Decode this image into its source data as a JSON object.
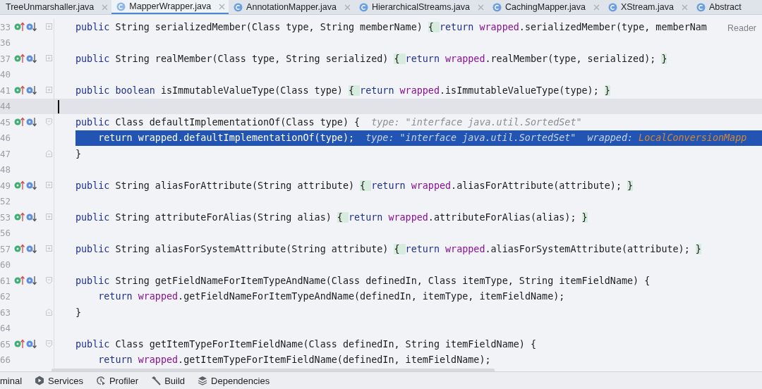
{
  "tabs": [
    {
      "label": "TreeUnmarshaller.java",
      "selected": false
    },
    {
      "label": "MapperWrapper.java",
      "selected": true
    },
    {
      "label": "AnnotationMapper.java",
      "selected": false
    },
    {
      "label": "HierarchicalStreams.java",
      "selected": false
    },
    {
      "label": "CachingMapper.java",
      "selected": false
    },
    {
      "label": "XStream.java",
      "selected": false
    },
    {
      "label": "Abstract",
      "selected": false
    }
  ],
  "reader_mode": "Reader",
  "lines": [
    {
      "number": "33",
      "kind": "folded",
      "markers": true,
      "selected": false,
      "current": false,
      "segments": [
        {
          "kind": "kw",
          "text": "public "
        },
        {
          "kind": "text",
          "text": "String serializedMember(Class type, String memberName) "
        },
        {
          "kind": "brace",
          "text": "{ "
        },
        {
          "kind": "kw",
          "text": "return "
        },
        {
          "kind": "field",
          "text": "wrapped"
        },
        {
          "kind": "text",
          "text": ".serializedMember(type, memberNam"
        }
      ]
    },
    {
      "number": "36",
      "kind": "blank",
      "markers": false,
      "selected": false,
      "current": false
    },
    {
      "number": "37",
      "kind": "folded",
      "markers": true,
      "selected": false,
      "current": false,
      "segments": [
        {
          "kind": "kw",
          "text": "public "
        },
        {
          "kind": "text",
          "text": "String realMember(Class type, String serialized) "
        },
        {
          "kind": "brace",
          "text": "{ "
        },
        {
          "kind": "kw",
          "text": "return "
        },
        {
          "kind": "field",
          "text": "wrapped"
        },
        {
          "kind": "text",
          "text": ".realMember(type, serialized); "
        },
        {
          "kind": "brace",
          "text": "}"
        }
      ]
    },
    {
      "number": "40",
      "kind": "blank",
      "markers": false,
      "selected": false,
      "current": false
    },
    {
      "number": "41",
      "kind": "folded",
      "markers": true,
      "selected": false,
      "current": false,
      "segments": [
        {
          "kind": "kw",
          "text": "public boolean "
        },
        {
          "kind": "text",
          "text": "isImmutableValueType(Class type) "
        },
        {
          "kind": "brace",
          "text": "{ "
        },
        {
          "kind": "kw",
          "text": "return "
        },
        {
          "kind": "field",
          "text": "wrapped"
        },
        {
          "kind": "text",
          "text": ".isImmutableValueType(type); "
        },
        {
          "kind": "brace",
          "text": "}"
        }
      ]
    },
    {
      "number": "44",
      "kind": "blank",
      "markers": false,
      "selected": false,
      "current": true
    },
    {
      "number": "45",
      "kind": "open",
      "markers": true,
      "selected": false,
      "current": false,
      "segments": [
        {
          "kind": "kw",
          "text": "public "
        },
        {
          "kind": "text",
          "text": "Class defaultImplementationOf(Class type) {"
        },
        {
          "kind": "hint",
          "text": "type: \"interface java.util.SortedSet\""
        }
      ]
    },
    {
      "number": "46",
      "kind": "body",
      "markers": false,
      "selected": true,
      "current": false,
      "segments": [
        {
          "kind": "kw",
          "text": "return "
        },
        {
          "kind": "field",
          "text": "wrapped"
        },
        {
          "kind": "text",
          "text": ".defaultImplementationOf(type);"
        },
        {
          "kind": "hint",
          "text": "type: \"interface java.util.SortedSet\""
        },
        {
          "kind": "hint",
          "text": "wrapped:"
        },
        {
          "kind": "hint-value",
          "text": "LocalConversionMapp"
        }
      ]
    },
    {
      "number": "47",
      "kind": "close",
      "markers": false,
      "selected": false,
      "current": false,
      "segments": [
        {
          "kind": "text",
          "text": "}"
        }
      ]
    },
    {
      "number": "48",
      "kind": "blank",
      "markers": false,
      "selected": false,
      "current": false
    },
    {
      "number": "49",
      "kind": "folded",
      "markers": true,
      "selected": false,
      "current": false,
      "segments": [
        {
          "kind": "kw",
          "text": "public "
        },
        {
          "kind": "text",
          "text": "String aliasForAttribute(String attribute) "
        },
        {
          "kind": "brace",
          "text": "{ "
        },
        {
          "kind": "kw",
          "text": "return "
        },
        {
          "kind": "field",
          "text": "wrapped"
        },
        {
          "kind": "text",
          "text": ".aliasForAttribute(attribute); "
        },
        {
          "kind": "brace",
          "text": "}"
        }
      ]
    },
    {
      "number": "52",
      "kind": "blank",
      "markers": false,
      "selected": false,
      "current": false
    },
    {
      "number": "53",
      "kind": "folded",
      "markers": true,
      "selected": false,
      "current": false,
      "segments": [
        {
          "kind": "kw",
          "text": "public "
        },
        {
          "kind": "text",
          "text": "String attributeForAlias(String alias) "
        },
        {
          "kind": "brace",
          "text": "{ "
        },
        {
          "kind": "kw",
          "text": "return "
        },
        {
          "kind": "field",
          "text": "wrapped"
        },
        {
          "kind": "text",
          "text": ".attributeForAlias(alias); "
        },
        {
          "kind": "brace",
          "text": "}"
        }
      ]
    },
    {
      "number": "56",
      "kind": "blank",
      "markers": false,
      "selected": false,
      "current": false
    },
    {
      "number": "57",
      "kind": "folded",
      "markers": true,
      "selected": false,
      "current": false,
      "segments": [
        {
          "kind": "kw",
          "text": "public "
        },
        {
          "kind": "text",
          "text": "String aliasForSystemAttribute(String attribute) "
        },
        {
          "kind": "brace",
          "text": "{ "
        },
        {
          "kind": "kw",
          "text": "return "
        },
        {
          "kind": "field",
          "text": "wrapped"
        },
        {
          "kind": "text",
          "text": ".aliasForSystemAttribute(attribute); "
        },
        {
          "kind": "brace",
          "text": "}"
        }
      ]
    },
    {
      "number": "60",
      "kind": "blank",
      "markers": false,
      "selected": false,
      "current": false
    },
    {
      "number": "61",
      "kind": "open",
      "markers": true,
      "selected": false,
      "current": false,
      "segments": [
        {
          "kind": "kw",
          "text": "public "
        },
        {
          "kind": "text",
          "text": "String getFieldNameForItemTypeAndName(Class definedIn, Class itemType, String itemFieldName) {"
        }
      ]
    },
    {
      "number": "62",
      "kind": "body",
      "markers": false,
      "selected": false,
      "current": false,
      "segments": [
        {
          "kind": "kw",
          "text": "return "
        },
        {
          "kind": "field",
          "text": "wrapped"
        },
        {
          "kind": "text",
          "text": ".getFieldNameForItemTypeAndName(definedIn, itemType, itemFieldName);"
        }
      ]
    },
    {
      "number": "63",
      "kind": "close",
      "markers": false,
      "selected": false,
      "current": false,
      "segments": [
        {
          "kind": "text",
          "text": "}"
        }
      ]
    },
    {
      "number": "64",
      "kind": "blank",
      "markers": false,
      "selected": false,
      "current": false
    },
    {
      "number": "65",
      "kind": "open",
      "markers": true,
      "selected": false,
      "current": false,
      "segments": [
        {
          "kind": "kw",
          "text": "public "
        },
        {
          "kind": "text",
          "text": "Class getItemTypeForItemFieldName(Class definedIn, String itemFieldName) {"
        }
      ]
    },
    {
      "number": "66",
      "kind": "body",
      "markers": false,
      "selected": false,
      "current": false,
      "segments": [
        {
          "kind": "kw",
          "text": "return "
        },
        {
          "kind": "field",
          "text": "wrapped"
        },
        {
          "kind": "text",
          "text": ".getItemTypeForItemFieldName(definedIn, itemFieldName);"
        }
      ]
    }
  ],
  "tool_windows": [
    {
      "label": "minal"
    },
    {
      "label": "Services"
    },
    {
      "label": "Profiler"
    },
    {
      "label": "Build"
    },
    {
      "label": "Dependencies"
    }
  ]
}
